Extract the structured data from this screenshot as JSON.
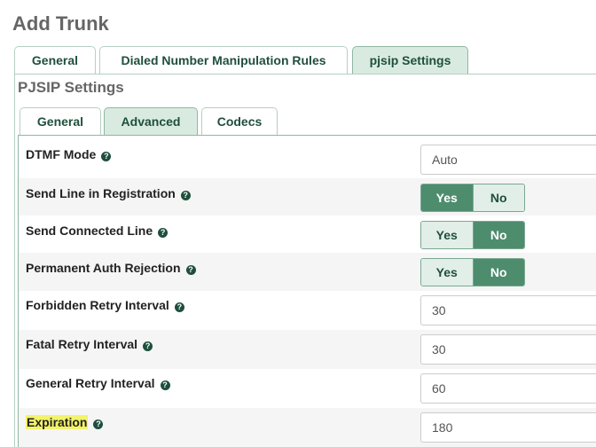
{
  "page": {
    "title": "Add Trunk"
  },
  "top_tabs": [
    {
      "label": "General",
      "active": false
    },
    {
      "label": "Dialed Number Manipulation Rules",
      "active": false
    },
    {
      "label": "pjsip Settings",
      "active": true
    }
  ],
  "section": {
    "title": "PJSIP Settings"
  },
  "inner_tabs": [
    {
      "label": "General",
      "active": false
    },
    {
      "label": "Advanced",
      "active": true
    },
    {
      "label": "Codecs",
      "active": false
    }
  ],
  "help_glyph": "?",
  "toggle_labels": {
    "yes": "Yes",
    "no": "No"
  },
  "fields": {
    "dtmf_mode": {
      "label": "DTMF Mode",
      "value": "Auto"
    },
    "send_line_in_registration": {
      "label": "Send Line in Registration",
      "selected": "Yes"
    },
    "send_connected_line": {
      "label": "Send Connected Line",
      "selected": "No"
    },
    "permanent_auth_rejection": {
      "label": "Permanent Auth Rejection",
      "selected": "No"
    },
    "forbidden_retry_interval": {
      "label": "Forbidden Retry Interval",
      "value": "30"
    },
    "fatal_retry_interval": {
      "label": "Fatal Retry Interval",
      "value": "30"
    },
    "general_retry_interval": {
      "label": "General Retry Interval",
      "value": "60"
    },
    "expiration": {
      "label": "Expiration",
      "value": "180",
      "highlighted": true
    }
  },
  "colors": {
    "accent": "#4e8c6e",
    "tab_active_bg": "#d9ebe1",
    "highlight": "#f3f36a"
  }
}
